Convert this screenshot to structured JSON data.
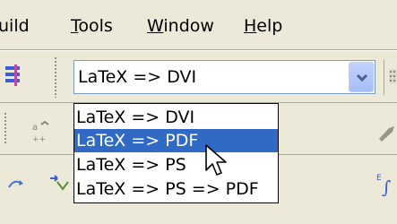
{
  "menubar": {
    "items": [
      {
        "label_pre": "",
        "label_u": "",
        "label_post": "uild"
      },
      {
        "label_pre": "",
        "label_u": "T",
        "label_post": "ools"
      },
      {
        "label_pre": "",
        "label_u": "W",
        "label_post": "indow"
      },
      {
        "label_pre": "",
        "label_u": "H",
        "label_post": "elp"
      }
    ]
  },
  "toolbar": {
    "combo": {
      "selected": "LaTeX => DVI",
      "options": [
        "LaTeX => DVI",
        "LaTeX => PDF",
        "LaTeX => PS",
        "LaTeX => PS => PDF"
      ],
      "highlighted_index": 1
    }
  },
  "colors": {
    "highlight": "#316ac5",
    "chrome": "#ece9d8",
    "combo_border": "#7f9db9"
  },
  "icons": [
    "build-icon",
    "grid-icon",
    "symbol-icon",
    "tool-icon",
    "arrow-cursor-icon"
  ]
}
